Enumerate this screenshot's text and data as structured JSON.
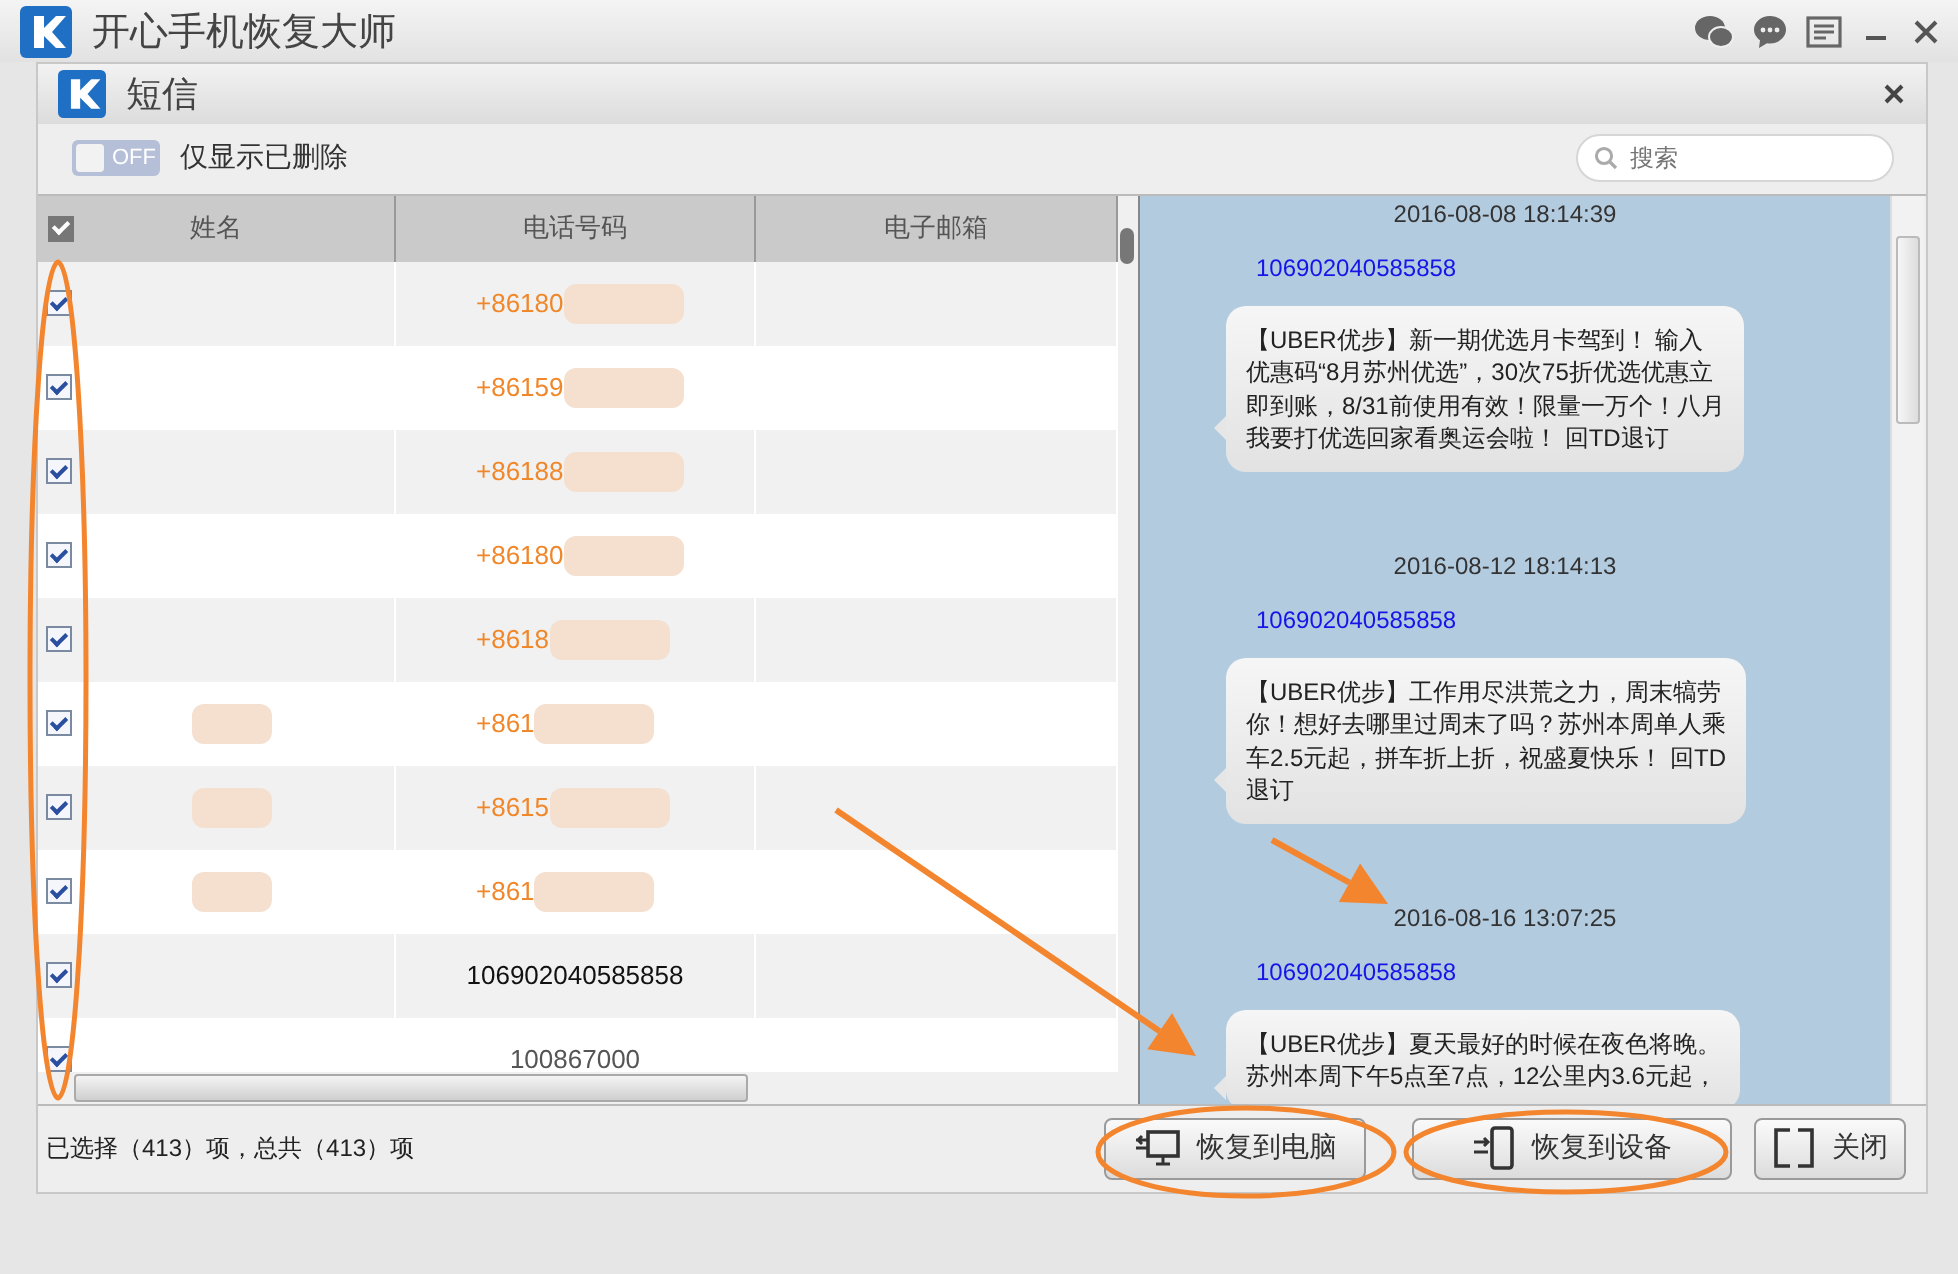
{
  "app": {
    "title": "开心手机恢复大师"
  },
  "dialog": {
    "title": "短信"
  },
  "toolbar": {
    "toggle": {
      "label": "OFF",
      "on": false
    },
    "filter_label": "仅显示已删除",
    "search": {
      "placeholder": "搜索"
    }
  },
  "table": {
    "select_all": {
      "checked": true
    },
    "columns": [
      "姓名",
      "电话号码",
      "电子邮箱"
    ],
    "rows": [
      {
        "checked": true,
        "phone": "+86180",
        "color": "#f0872a",
        "name_blurred": false,
        "phone_blurred": true
      },
      {
        "checked": true,
        "phone": "+86159",
        "color": "#f0872a",
        "name_blurred": false,
        "phone_blurred": true
      },
      {
        "checked": true,
        "phone": "+86188",
        "color": "#f0872a",
        "name_blurred": false,
        "phone_blurred": true
      },
      {
        "checked": true,
        "phone": "+86180",
        "color": "#f0872a",
        "name_blurred": false,
        "phone_blurred": true
      },
      {
        "checked": true,
        "phone": "+8618",
        "color": "#f0872a",
        "name_blurred": false,
        "phone_blurred": true
      },
      {
        "checked": true,
        "phone": "+861",
        "color": "#f0872a",
        "name_blurred": true,
        "phone_blurred": true
      },
      {
        "checked": true,
        "phone": "+8615",
        "color": "#f0872a",
        "name_blurred": true,
        "phone_blurred": true
      },
      {
        "checked": true,
        "phone": "+861",
        "color": "#f0872a",
        "name_blurred": true,
        "phone_blurred": true
      },
      {
        "checked": true,
        "phone": "106902040585858",
        "color": "#111111",
        "name_blurred": false,
        "phone_blurred": false
      },
      {
        "checked": true,
        "phone": "100867000",
        "color": "#555555",
        "name_blurred": false,
        "phone_blurred": false
      }
    ]
  },
  "messages": [
    {
      "time": "2016-08-08 18:14:39",
      "sender": "106902040585858",
      "lines": [
        "【UBER优步】新一期优选月卡驾到！ 输入",
        "优惠码“8月苏州优选”，30次75折优选优惠立",
        "即到账，8/31前使用有效！限量一万个！八月",
        "我要打优选回家看奥运会啦！ 回TD退订"
      ]
    },
    {
      "time": "2016-08-12 18:14:13",
      "sender": "106902040585858",
      "lines": [
        "【UBER优步】工作用尽洪荒之力，周末犒劳",
        "你！想好去哪里过周末了吗？苏州本周单人乘",
        "车2.5元起，拼车折上折，祝盛夏快乐！ 回TD",
        "退订"
      ]
    },
    {
      "time": "2016-08-16 13:07:25",
      "sender": "106902040585858",
      "lines": [
        "【UBER优步】夏天最好的时候在夜色将晚。",
        "苏州本周下午5点至7点，12公里内3.6元起，"
      ]
    }
  ],
  "footer": {
    "status": "已选择（413）项，总共（413）项",
    "buttons": [
      {
        "label": "恢复到电脑",
        "kind": "computer"
      },
      {
        "label": "恢复到设备",
        "kind": "device"
      },
      {
        "label": "关闭",
        "kind": "close"
      }
    ]
  }
}
